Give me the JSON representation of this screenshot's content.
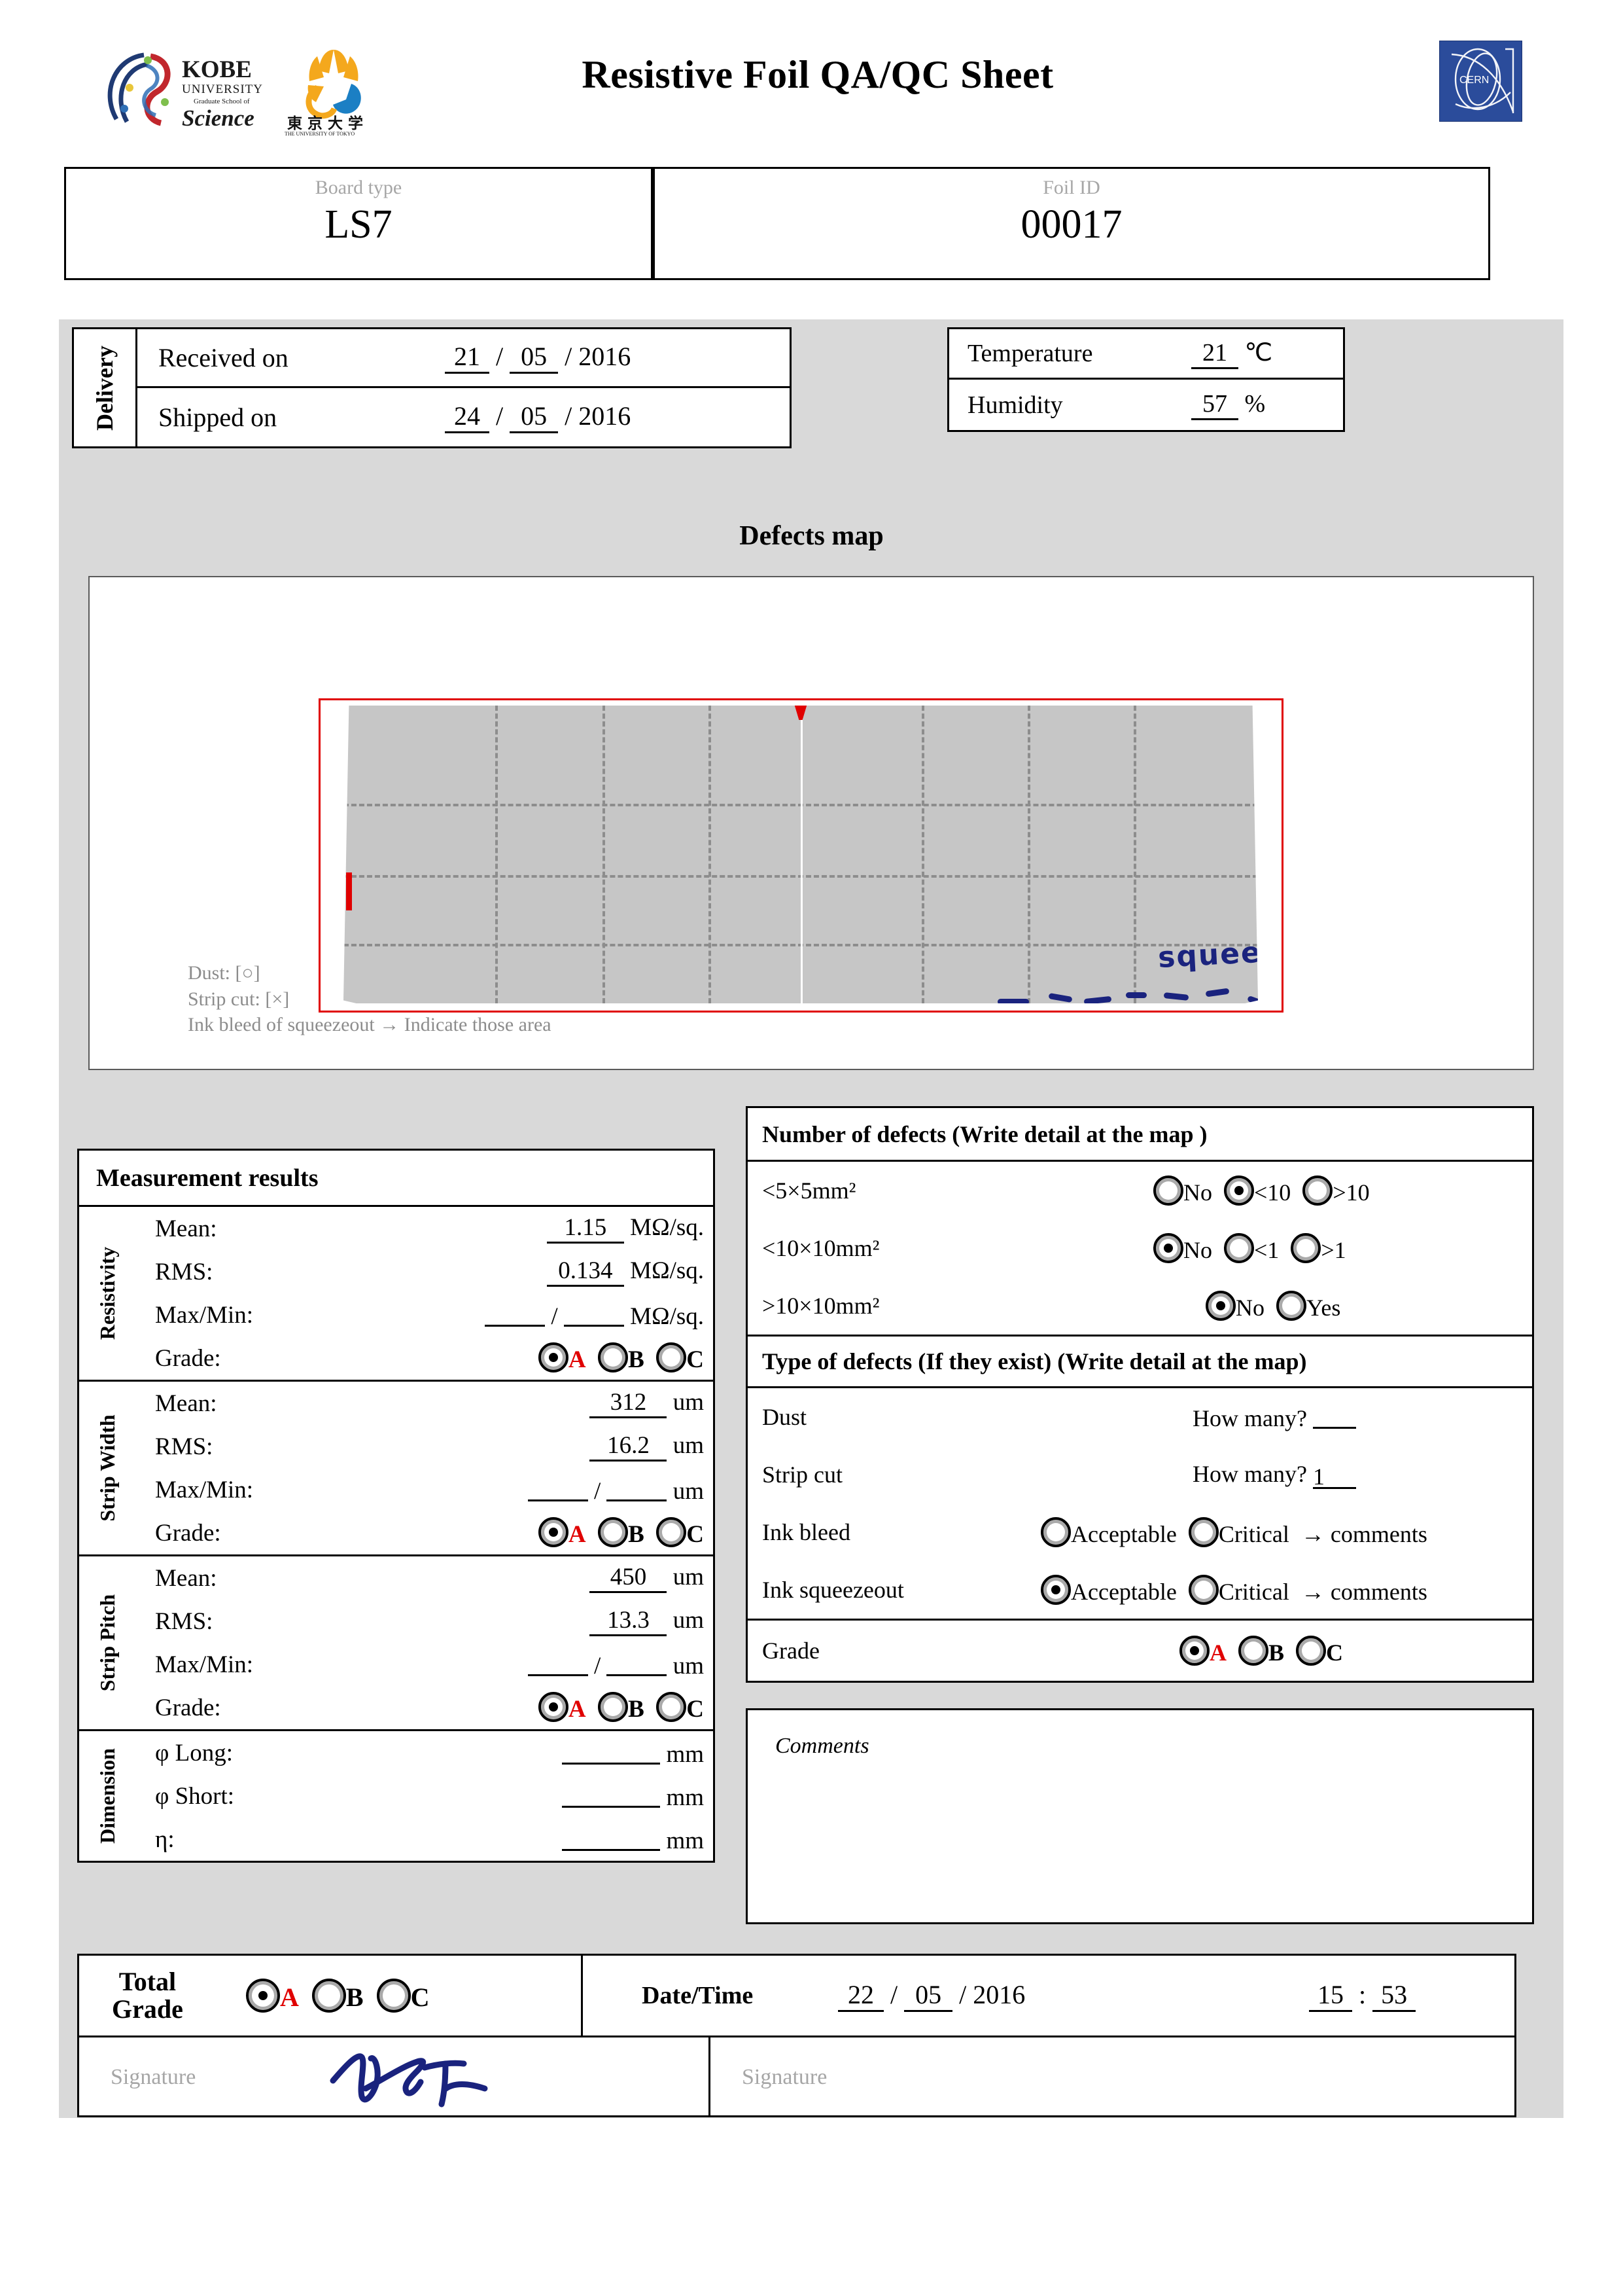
{
  "header": {
    "title": "Resistive Foil QA/QC Sheet",
    "logo_kobe": "kobe-university-graduate-school-of-science-logo",
    "logo_tokyo": "university-of-tokyo-logo",
    "logo_cern": "cern-logo"
  },
  "identification": {
    "board_type_label": "Board type",
    "board_type_value": "LS7",
    "foil_id_label": "Foil ID",
    "foil_id_value": "00017"
  },
  "delivery": {
    "section_label": "Delivery",
    "received_label": "Received on",
    "received_day": "21",
    "received_month": "05",
    "received_year": "2016",
    "shipped_label": "Shipped on",
    "shipped_day": "24",
    "shipped_month": "05",
    "shipped_year": "2016"
  },
  "environment": {
    "temperature_label": "Temperature",
    "temperature_value": "21",
    "temperature_unit": "℃",
    "humidity_label": "Humidity",
    "humidity_value": "57",
    "humidity_unit": "%"
  },
  "defects_map": {
    "heading": "Defects map",
    "handwritten_strip_cut": "X",
    "handwritten_squeezeout": "squeezeout",
    "legend_dust": "Dust: [○]",
    "legend_strip_cut": "Strip cut: [×]",
    "legend_ink": "Ink bleed of squeezeout  →  Indicate those area",
    "foil_color": "#c6c6c6",
    "frame_color": "#e00000",
    "ink_color": "#1a237e"
  },
  "measurement": {
    "title": "Measurement results",
    "groups": [
      {
        "name": "Resistivity",
        "mean_label": "Mean:",
        "mean_value": "1.15",
        "mean_unit": "MΩ/sq.",
        "rms_label": "RMS:",
        "rms_value": "0.134",
        "rms_unit": "MΩ/sq.",
        "maxmin_label": "Max/Min:",
        "maxmin_max": "",
        "maxmin_min": "",
        "maxmin_unit": "MΩ/sq.",
        "grade_label": "Grade:",
        "grade": "A"
      },
      {
        "name": "Strip Width",
        "mean_label": "Mean:",
        "mean_value": "312",
        "mean_unit": "um",
        "rms_label": "RMS:",
        "rms_value": "16.2",
        "rms_unit": "um",
        "maxmin_label": "Max/Min:",
        "maxmin_max": "",
        "maxmin_min": "",
        "maxmin_unit": "um",
        "grade_label": "Grade:",
        "grade": "A"
      },
      {
        "name": "Strip Pitch",
        "mean_label": "Mean:",
        "mean_value": "450",
        "mean_unit": "um",
        "rms_label": "RMS:",
        "rms_value": "13.3",
        "rms_unit": "um",
        "maxmin_label": "Max/Min:",
        "maxmin_max": "",
        "maxmin_min": "",
        "maxmin_unit": "um",
        "grade_label": "Grade:",
        "grade": "A"
      }
    ],
    "dimension": {
      "name": "Dimension",
      "long_label": "φ Long:",
      "long_value": "",
      "long_unit": "mm",
      "short_label": "φ Short:",
      "short_value": "",
      "short_unit": "mm",
      "eta_label": "η:",
      "eta_value": "",
      "eta_unit": "mm"
    },
    "grade_options": [
      "A",
      "B",
      "C"
    ]
  },
  "number_of_defects": {
    "title": "Number of defects (Write detail at the map )",
    "rows": [
      {
        "label": "<5×5mm²",
        "options": [
          "No",
          "<10",
          ">10"
        ],
        "selected": "<10"
      },
      {
        "label": "<10×10mm²",
        "options": [
          "No",
          "<1",
          ">1"
        ],
        "selected": "No"
      },
      {
        "label": ">10×10mm²",
        "options": [
          "No",
          "Yes"
        ],
        "selected": "No"
      }
    ]
  },
  "type_of_defects": {
    "title": "Type of defects (If they exist) (Write detail at the map)",
    "dust_label": "Dust",
    "dust_question": "How many?",
    "dust_value": "",
    "strip_cut_label": "Strip cut",
    "strip_cut_question": "How many?",
    "strip_cut_value": "1",
    "ink_bleed_label": "Ink bleed",
    "ink_bleed_options": [
      "Acceptable",
      "Critical"
    ],
    "ink_bleed_selected": "",
    "ink_bleed_suffix": "→  comments",
    "ink_squeezeout_label": "Ink squeezeout",
    "ink_squeezeout_options": [
      "Acceptable",
      "Critical"
    ],
    "ink_squeezeout_selected": "Acceptable",
    "ink_squeezeout_suffix": "→  comments",
    "grade_label": "Grade",
    "grade_selected": "A"
  },
  "comments": {
    "label": "Comments",
    "text": ""
  },
  "footer": {
    "total_grade_label": "Total\nGrade",
    "total_grade_line1": "Total",
    "total_grade_line2": "Grade",
    "total_grade_selected": "A",
    "datetime_label": "Date/Time",
    "date_day": "22",
    "date_month": "05",
    "date_year": "2016",
    "time_hour": "15",
    "time_minute": "53",
    "signature_label_left": "Signature",
    "signature_label_right": "Signature",
    "signature_present_left": true,
    "signature_present_right": false
  }
}
